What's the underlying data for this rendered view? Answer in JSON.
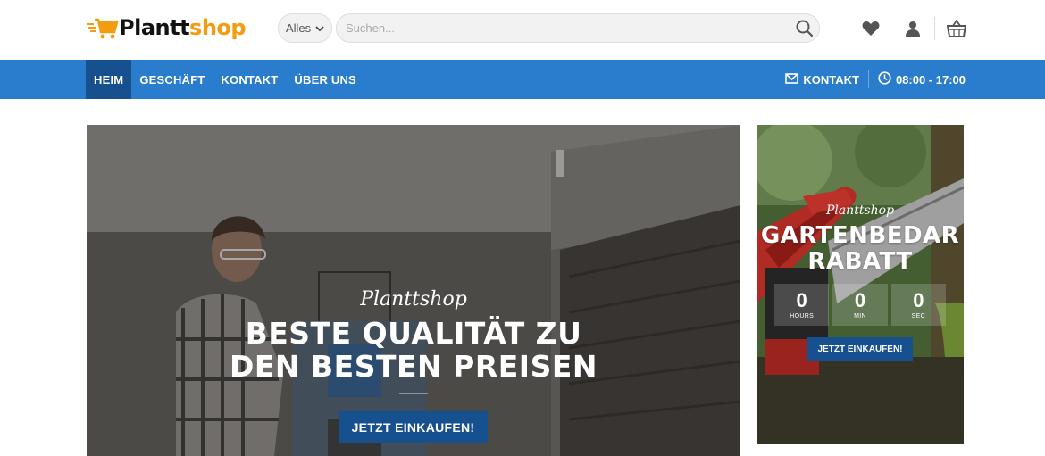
{
  "header": {
    "logo": {
      "part1": "Plantt",
      "part2": "shop"
    },
    "search": {
      "category": "Alles",
      "placeholder": "Suchen..."
    },
    "icons": [
      "heart-icon",
      "user-icon",
      "basket-icon"
    ]
  },
  "nav": {
    "items": [
      {
        "label": "HEIM",
        "active": true
      },
      {
        "label": "GESCHÄFT"
      },
      {
        "label": "KONTAKT"
      },
      {
        "label": "ÜBER UNS"
      }
    ],
    "contact_label": "KONTAKT",
    "hours": "08:00 - 17:00"
  },
  "hero": {
    "script": "Planttshop",
    "title_line1": "BESTE QUALITÄT ZU",
    "title_line2": "DEN BESTEN PREISEN",
    "button": "JETZT EINKAUFEN!"
  },
  "promo": {
    "script": "Planttshop",
    "title_line1": "GARTENBEDAR",
    "title_line2": "RABATT",
    "countdown": [
      {
        "value": "0",
        "label": "HOURS"
      },
      {
        "value": "0",
        "label": "MIN"
      },
      {
        "value": "0",
        "label": "SEC"
      }
    ],
    "button": "JETZT EINKAUFEN!"
  },
  "colors": {
    "nav_bg": "#2a7dcc",
    "nav_active": "#17508f",
    "button_bg": "#17508f",
    "logo_accent": "#f39c12"
  }
}
